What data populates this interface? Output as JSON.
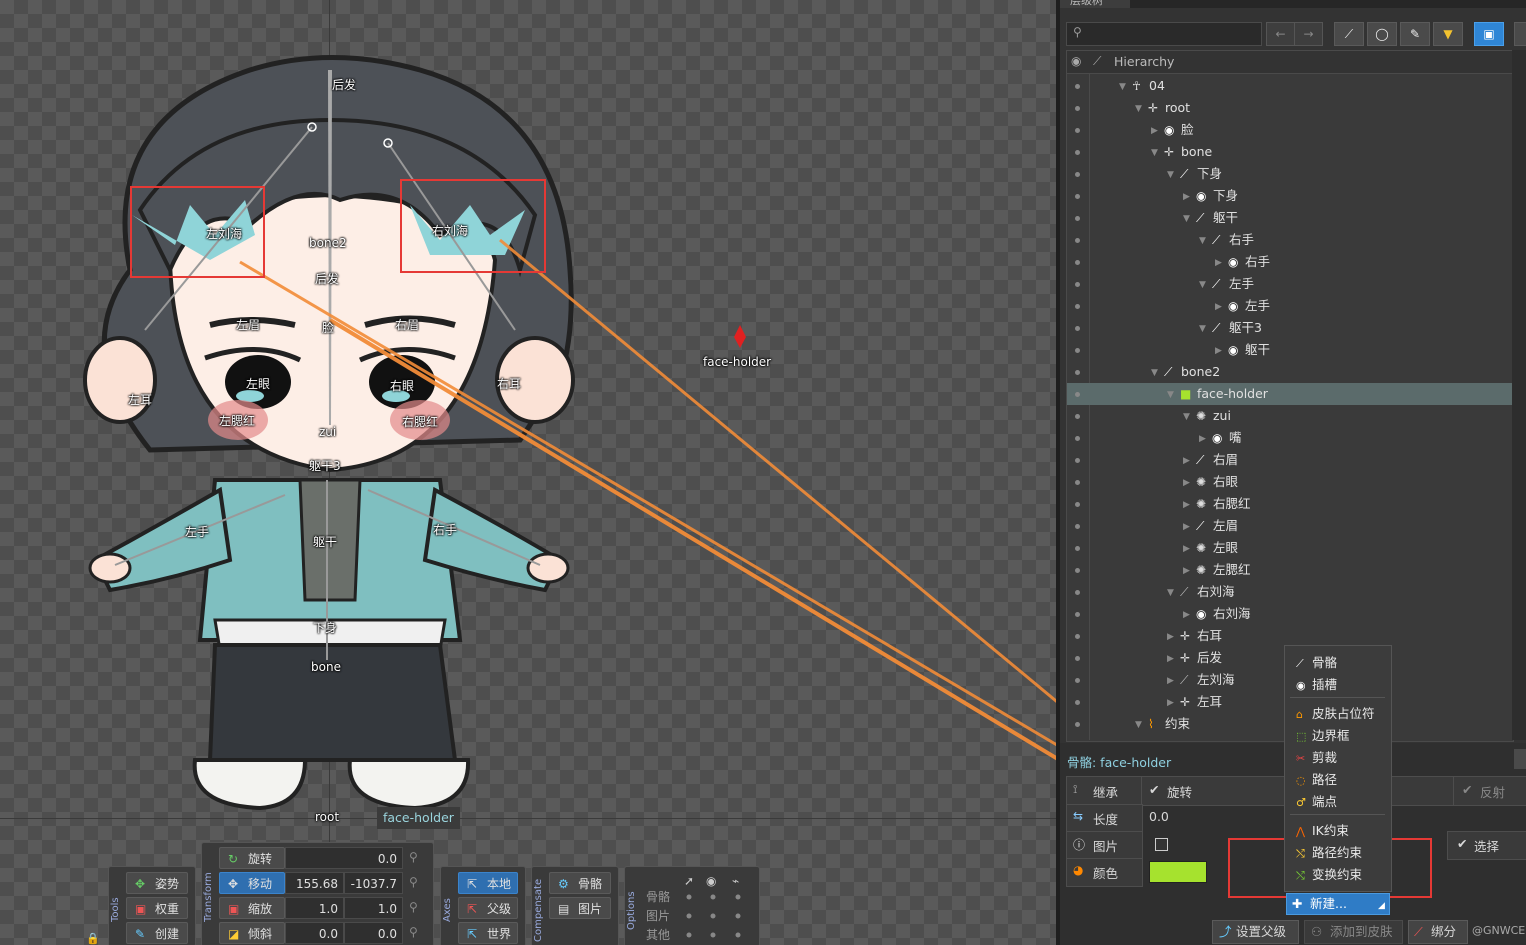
{
  "viewport": {
    "bone_labels": [
      "后发",
      "左刘海",
      "右刘海",
      "bone2",
      "后发",
      "左眉",
      "右眉",
      "脸",
      "左眼",
      "右眼",
      "左耳",
      "右耳",
      "左腮红",
      "右腮红",
      "zui",
      "躯干3",
      "左手",
      "右手",
      "躯干",
      "下身",
      "bone",
      "root"
    ],
    "face_holder_label": "face-holder",
    "selected_tag": "face-holder"
  },
  "toolbar": {
    "tools": {
      "title": "Tools",
      "pose": "姿势",
      "weights": "权重",
      "create": "创建"
    },
    "transform": {
      "title": "Transform",
      "rotate": {
        "label": "旋转",
        "v1": "0.0"
      },
      "translate": {
        "label": "移动",
        "v1": "155.68",
        "v2": "-1037.7"
      },
      "scale": {
        "label": "缩放",
        "v1": "1.0",
        "v2": "1.0"
      },
      "shear": {
        "label": "倾斜",
        "v1": "0.0",
        "v2": "0.0"
      }
    },
    "axes": {
      "title": "Axes",
      "local": "本地",
      "parent": "父级",
      "world": "世界"
    },
    "compensate": {
      "title": "Compensate",
      "bones": "骨骼",
      "images": "图片"
    },
    "options": {
      "title": "Options",
      "rows": [
        "骨骼",
        "图片",
        "其他"
      ]
    }
  },
  "panel": {
    "title": "层级树",
    "search_placeholder": "",
    "hierarchy_header": "Hierarchy",
    "tree": [
      {
        "label": "04",
        "icon": "skeleton-icon",
        "depth": 0,
        "expanded": true
      },
      {
        "label": "root",
        "icon": "bone-root-icon",
        "depth": 1,
        "expanded": true
      },
      {
        "label": "脸",
        "icon": "slot-icon",
        "depth": 2,
        "expanded": false
      },
      {
        "label": "bone",
        "icon": "bone-root-icon",
        "depth": 2,
        "expanded": true
      },
      {
        "label": "下身",
        "icon": "bone-icon",
        "depth": 3,
        "expanded": true
      },
      {
        "label": "下身",
        "icon": "slot-icon",
        "depth": 4,
        "expanded": false
      },
      {
        "label": "躯干",
        "icon": "bone-icon",
        "depth": 4,
        "expanded": true
      },
      {
        "label": "右手",
        "icon": "bone-icon",
        "depth": 5,
        "expanded": true
      },
      {
        "label": "右手",
        "icon": "slot-icon",
        "depth": 6,
        "expanded": false
      },
      {
        "label": "左手",
        "icon": "bone-icon",
        "depth": 5,
        "expanded": true
      },
      {
        "label": "左手",
        "icon": "slot-icon",
        "depth": 6,
        "expanded": false
      },
      {
        "label": "躯干3",
        "icon": "bone-icon",
        "depth": 5,
        "expanded": true
      },
      {
        "label": "躯干",
        "icon": "slot-icon",
        "depth": 6,
        "expanded": false
      },
      {
        "label": "bone2",
        "icon": "bone-icon",
        "depth": 2,
        "expanded": true
      },
      {
        "label": "face-holder",
        "icon": "face-holder-icon",
        "depth": 3,
        "expanded": true,
        "selected": true
      },
      {
        "label": "zui",
        "icon": "gear-icon",
        "depth": 4,
        "expanded": true
      },
      {
        "label": "嘴",
        "icon": "slot-icon",
        "depth": 5,
        "expanded": false
      },
      {
        "label": "右眉",
        "icon": "bone-icon",
        "depth": 4,
        "expanded": false
      },
      {
        "label": "右眼",
        "icon": "gear-icon",
        "depth": 4,
        "expanded": false
      },
      {
        "label": "右腮红",
        "icon": "gear-icon",
        "depth": 4,
        "expanded": false
      },
      {
        "label": "左眉",
        "icon": "bone-icon",
        "depth": 4,
        "expanded": false
      },
      {
        "label": "左眼",
        "icon": "gear-icon",
        "depth": 4,
        "expanded": false
      },
      {
        "label": "左腮红",
        "icon": "gear-icon",
        "depth": 4,
        "expanded": false
      },
      {
        "label": "右刘海",
        "icon": "bone-outline-icon",
        "depth": 3,
        "expanded": true
      },
      {
        "label": "右刘海",
        "icon": "slot-icon",
        "depth": 4,
        "expanded": false
      },
      {
        "label": "右耳",
        "icon": "bone-root-icon",
        "depth": 3,
        "expanded": false
      },
      {
        "label": "后发",
        "icon": "bone-root-icon",
        "depth": 3,
        "expanded": false
      },
      {
        "label": "左刘海",
        "icon": "bone-outline-icon",
        "depth": 3,
        "expanded": false
      },
      {
        "label": "左耳",
        "icon": "bone-root-icon",
        "depth": 3,
        "expanded": false
      },
      {
        "label": "约束",
        "icon": "constraint-icon",
        "depth": 1,
        "expanded": true
      }
    ],
    "context_menu": [
      "骨骼",
      "插槽",
      "皮肤占位符",
      "边界框",
      "剪裁",
      "路径",
      "端点",
      "IK约束",
      "路径约束",
      "变换约束"
    ],
    "new_button": "新建...",
    "props": {
      "header": "骨骼: face-holder",
      "inherit_label": "继承",
      "rotate_label": "旋转",
      "reflect_label": "反射",
      "length_label": "长度",
      "length_value": "0.0",
      "image_label": "图片",
      "select_label": "选择",
      "color_label": "颜色",
      "color": "#a6e22e"
    },
    "footer": {
      "set_parent": "设置父级",
      "add_to_skin": "添加到皮肤",
      "weights": "绑分",
      "watermark": "@GNWCE"
    }
  }
}
